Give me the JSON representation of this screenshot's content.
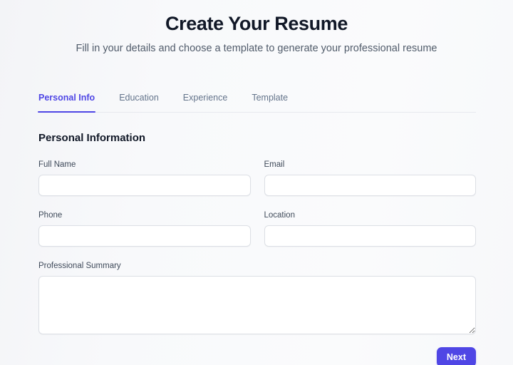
{
  "header": {
    "title": "Create Your Resume",
    "subtitle": "Fill in your details and choose a template to generate your professional resume"
  },
  "tabs": [
    {
      "label": "Personal Info",
      "active": true
    },
    {
      "label": "Education",
      "active": false
    },
    {
      "label": "Experience",
      "active": false
    },
    {
      "label": "Template",
      "active": false
    }
  ],
  "form": {
    "section_title": "Personal Information",
    "fields": {
      "full_name": {
        "label": "Full Name",
        "value": "",
        "placeholder": ""
      },
      "email": {
        "label": "Email",
        "value": "",
        "placeholder": ""
      },
      "phone": {
        "label": "Phone",
        "value": "",
        "placeholder": ""
      },
      "location": {
        "label": "Location",
        "value": "",
        "placeholder": ""
      },
      "summary": {
        "label": "Professional Summary",
        "value": "",
        "placeholder": ""
      }
    }
  },
  "footer": {
    "next_label": "Next"
  },
  "colors": {
    "accent": "#4f46e5",
    "page_background": "#f8f9fb",
    "title_text": "#111827",
    "muted_text": "#64748b",
    "input_border": "#dcdfe5",
    "input_background": "#ffffff"
  }
}
